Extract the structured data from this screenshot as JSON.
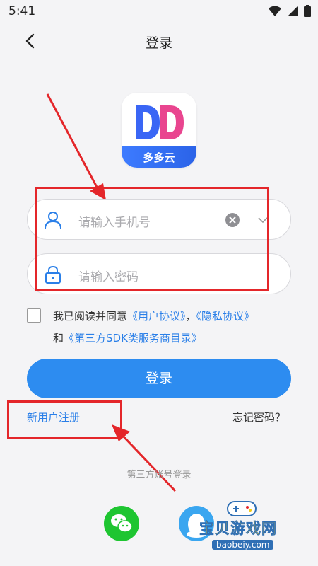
{
  "status_bar": {
    "time": "5:41"
  },
  "header": {
    "title": "登录"
  },
  "logo": {
    "text": "多多云",
    "letters": "DD"
  },
  "phone": {
    "placeholder": "请输入手机号"
  },
  "password": {
    "placeholder": "请输入密码"
  },
  "agreement": {
    "prefix": "我已阅读并同意",
    "user_agreement": "《用户协议》",
    "sep": "，",
    "privacy": "《隐私协议》",
    "and": "和",
    "sdk_list": "《第三方SDK类服务商目录》"
  },
  "login_button": "登录",
  "register": "新用户注册",
  "forgot": "忘记密码？",
  "third_party": {
    "label": "第三方账号登录"
  },
  "watermark": {
    "title": "宝贝游戏网",
    "url": "baobeiy.com"
  },
  "colors": {
    "primary": "#2d8cf0",
    "link": "#2a7fe8",
    "annotation_red": "#e4262a",
    "wechat": "#1ec531",
    "qq": "#3aa6f0"
  }
}
